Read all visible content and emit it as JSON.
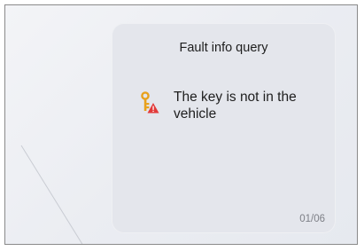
{
  "card": {
    "title": "Fault info query",
    "fault_message": "The key is not in the vehicle",
    "page_indicator": "01/06",
    "fault_icon": "key-warning-icon"
  },
  "colors": {
    "card_background": "#e4e6ec",
    "key_icon": "#e8a11c",
    "warning_icon": "#e23a3a",
    "text": "#1e1e1e",
    "page_indicator": "#7d7f86"
  }
}
